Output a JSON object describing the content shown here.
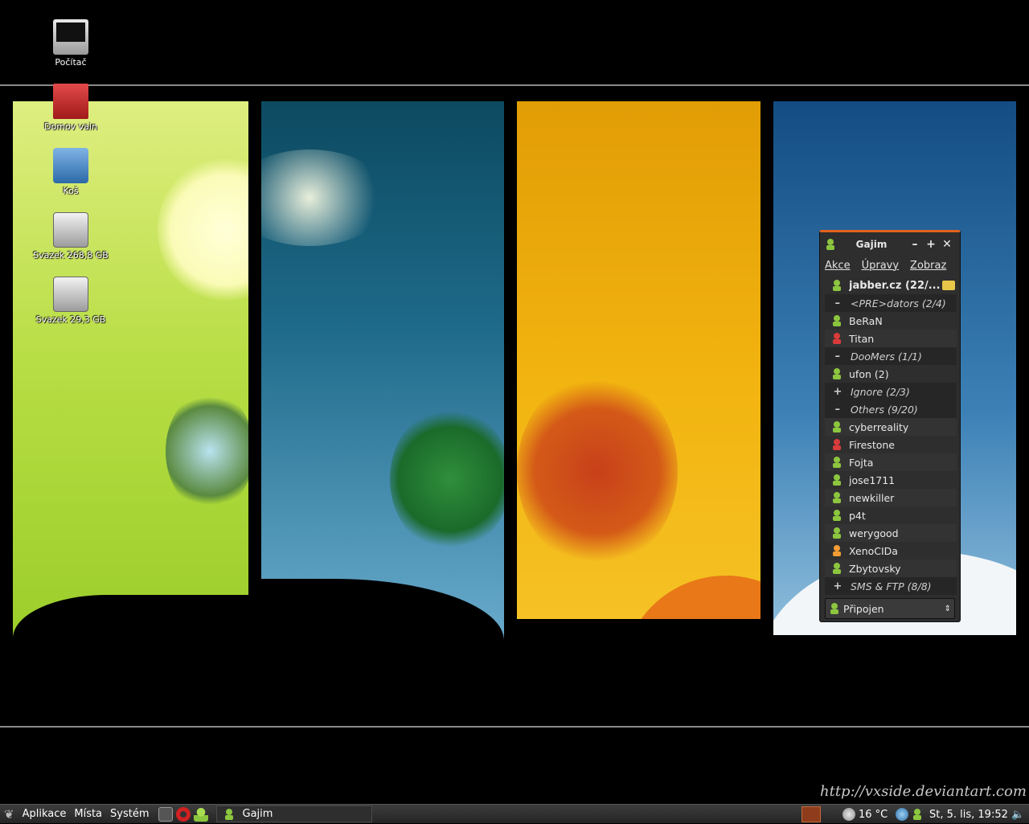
{
  "desktop": {
    "icons": [
      {
        "label": "Počítač",
        "icon": "computer-icon"
      },
      {
        "label": "Domov vain",
        "icon": "home-folder-icon"
      },
      {
        "label": "Koš",
        "icon": "trash-icon"
      },
      {
        "label": "Svazek 268,8 GB",
        "icon": "drive-icon"
      },
      {
        "label": "Svazek 29,3 GB",
        "icon": "drive-icon"
      }
    ],
    "watermark": "http://vxside.deviantart.com"
  },
  "gajim": {
    "title": "Gajim",
    "controls": {
      "minimize": "–",
      "maximize": "+",
      "close": "✕"
    },
    "menu": [
      "Akce",
      "Úpravy",
      "Zobraz"
    ],
    "account": "jabber.cz (22/...",
    "groups": [
      {
        "expander": "–",
        "label": "<PRE>dators (2/4)",
        "contacts": [
          {
            "name": "BeRaN",
            "status": "online"
          },
          {
            "name": "Titan",
            "status": "dnd"
          }
        ]
      },
      {
        "expander": "–",
        "label": "DooMers (1/1)",
        "contacts": [
          {
            "name": "ufon (2)",
            "status": "online"
          }
        ]
      },
      {
        "expander": "+",
        "label": "Ignore (2/3)",
        "contacts": []
      },
      {
        "expander": "–",
        "label": "Others (9/20)",
        "contacts": [
          {
            "name": "cyberreality",
            "status": "online"
          },
          {
            "name": "Firestone",
            "status": "dnd"
          },
          {
            "name": "Fojta",
            "status": "online"
          },
          {
            "name": "jose1711",
            "status": "online"
          },
          {
            "name": "newkiller",
            "status": "online"
          },
          {
            "name": "p4t",
            "status": "online"
          },
          {
            "name": "werygood",
            "status": "online"
          },
          {
            "name": "XenoCIDa",
            "status": "away"
          },
          {
            "name": "Zbytovsky",
            "status": "online"
          }
        ]
      },
      {
        "expander": "+",
        "label": "SMS & FTP (8/8)",
        "contacts": []
      }
    ],
    "status": "Připojen",
    "status_colors": {
      "online": "#8cc63f",
      "dnd": "#d93b3b",
      "away": "#f39c33"
    }
  },
  "taskbar": {
    "menus": [
      "Aplikace",
      "Místa",
      "Systém"
    ],
    "task": "Gajim",
    "weather": "16 °C",
    "clock": "St,  5. lis, 19:52"
  }
}
